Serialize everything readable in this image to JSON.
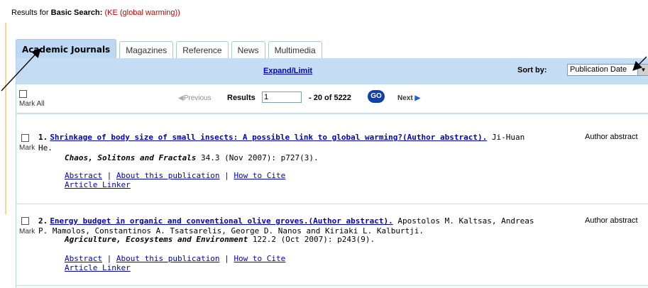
{
  "header": {
    "results_for_label": "Results for",
    "search_type": "Basic Search:",
    "query": "(KE (global warming))"
  },
  "tabs": [
    {
      "label": "Academic Journals",
      "active": true
    },
    {
      "label": "Magazines",
      "active": false
    },
    {
      "label": "Reference",
      "active": false
    },
    {
      "label": "News",
      "active": false
    },
    {
      "label": "Multimedia",
      "active": false
    }
  ],
  "toolbar": {
    "expand_limit": "Expand/Limit",
    "sort_by_label": "Sort by:",
    "sort_by_value": "Publication Date"
  },
  "pager": {
    "mark_all": "Mark All",
    "previous": "Previous",
    "results_label": "Results",
    "start_value": "1",
    "range_text": "- 20  of 5222",
    "go": "GO",
    "next": "Next"
  },
  "records": [
    {
      "number": "1.",
      "title": "Shrinkage of body size of small insects: A possible link to global warming?(Author abstract).",
      "authors_line1": " Ji-Huan",
      "authors_line2": "He.",
      "journal": "Chaos, Solitons and Fractals",
      "citation": " 34.3 (Nov 2007): p727(3).",
      "mark": "Mark",
      "type": "Author abstract",
      "links": {
        "abstract": "Abstract",
        "sep1": " | ",
        "about": "About this publication",
        "sep2": " | ",
        "cite": "How to Cite",
        "linker": "Article Linker"
      }
    },
    {
      "number": "2.",
      "title": "Energy budget in organic and conventional olive groves.(Author abstract).",
      "authors_line1": " Apostolos M. Kaltsas, Andreas",
      "authors_line2": "P. Mamolos, Constantinos A. Tsatsarelis, George D. Nanos and Kiriaki L. Kalburtji.",
      "journal": "Agriculture, Ecosystems and Environment",
      "citation": " 122.2 (Oct 2007): p243(9).",
      "mark": "Mark",
      "type": "Author abstract",
      "links": {
        "abstract": "Abstract",
        "sep1": " | ",
        "about": "About this publication",
        "sep2": " | ",
        "cite": "How to Cite",
        "linker": "Article Linker"
      }
    }
  ],
  "colors": {
    "tab_active": "#bcd8f2",
    "toolbar": "#c4dcf4",
    "link": "#0000cc",
    "query": "#cc0000"
  }
}
